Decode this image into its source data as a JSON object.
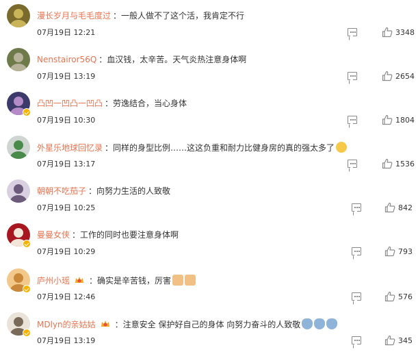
{
  "comments": [
    {
      "user": "漫长岁月与毛毛度过",
      "text": "一般人做不了这个活，我肯定不行",
      "time": "07月19日 12:21",
      "likes": "3348",
      "verified": false,
      "badge": false,
      "emojis": []
    },
    {
      "user": "Nenstairor56Q",
      "text": "血汉钱，太辛苦。天气炎热注意身体啊",
      "time": "07月19日 13:19",
      "likes": "2654",
      "verified": false,
      "badge": false,
      "emojis": []
    },
    {
      "user": "凸凹一凹凸一凹凸",
      "text": "劳逸结合，当心身体",
      "time": "07月19日 10:30",
      "likes": "1804",
      "verified": true,
      "badge": false,
      "emojis": []
    },
    {
      "user": "外星乐地球回忆录",
      "text": "同样的身型比例……这这负重和耐力比健身房的真的强太多了",
      "time": "07月19日 13:17",
      "likes": "1536",
      "verified": false,
      "badge": false,
      "emojis": [
        "strong"
      ]
    },
    {
      "user": "朝朝不吃茄子",
      "text": "向努力生活的人致敬",
      "time": "07月19日 10:25",
      "likes": "842",
      "verified": false,
      "badge": false,
      "emojis": []
    },
    {
      "user": "曼曼女侠",
      "text": "工作的同时也要注意身体啊",
      "time": "07月19日 10:29",
      "likes": "793",
      "verified": true,
      "badge": false,
      "emojis": []
    },
    {
      "user": "庐州小瑶",
      "text": "确实是辛苦钱，厉害",
      "time": "07月19日 12:46",
      "likes": "576",
      "verified": true,
      "badge": true,
      "emojis": [
        "thumbs-up",
        "thumbs-up"
      ]
    },
    {
      "user": "MDlyn的亲姑姑",
      "text": "注意安全 保护好自己的身体 向努力奋斗的人致敬",
      "time": "07月19日 13:19",
      "likes": "345",
      "verified": true,
      "badge": true,
      "emojis": [
        "sleepy",
        "sleepy",
        "sleepy"
      ]
    }
  ],
  "icons": {
    "reply": "comment-icon",
    "like": "thumbs-up-icon",
    "verified": "verified-badge-icon"
  },
  "colors": {
    "username": "#eb7350",
    "text": "#333333",
    "icon": "#8a8a8a",
    "verified": "#f6b400"
  }
}
